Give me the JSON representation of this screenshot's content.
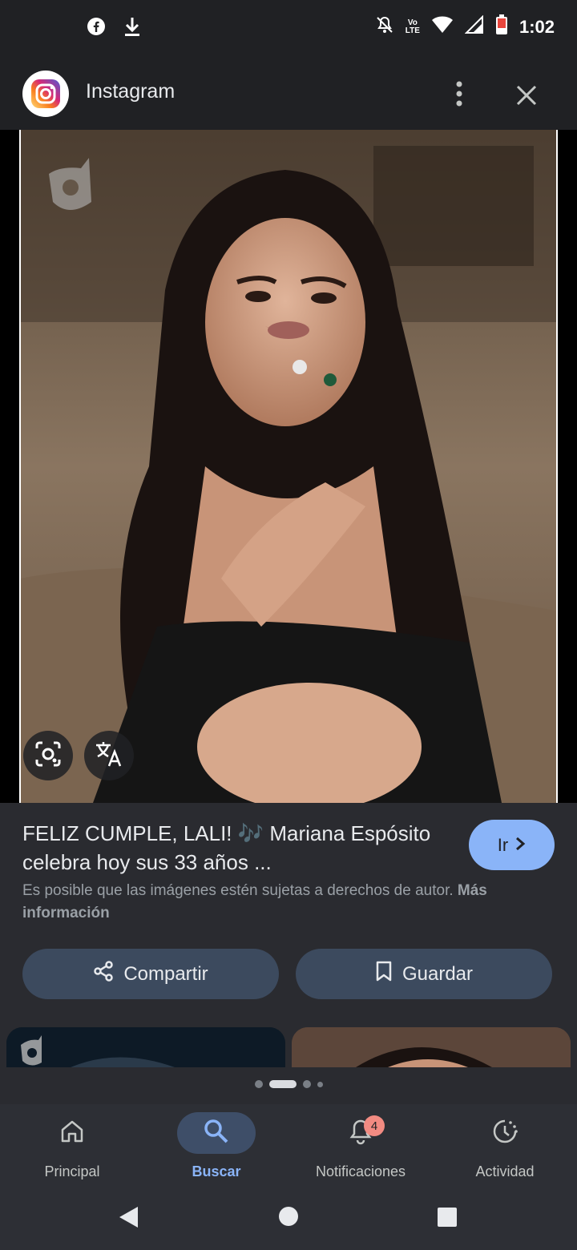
{
  "status_bar": {
    "time": "1:02",
    "volte_top": "Vo",
    "volte_bottom": "LTE",
    "left_icons": [
      "facebook-icon",
      "download-icon"
    ],
    "right_icons": [
      "notifications-off-icon",
      "volte-icon",
      "wifi-icon",
      "signal-icon",
      "battery-icon"
    ],
    "battery_color": "#f28b82"
  },
  "header": {
    "app_name": "Instagram",
    "actions": [
      "more-icon",
      "close-icon"
    ]
  },
  "image": {
    "overlay_buttons": [
      "lens-icon",
      "translate-icon"
    ]
  },
  "result": {
    "title": "FELIZ CUMPLE, LALI! 🎶 Mariana Espósito celebra hoy sus 33 años ...",
    "go_label": "Ir",
    "copyright_text": "Es posible que las imágenes estén sujetas a derechos de autor.",
    "copyright_link": "Más información",
    "share_label": "Compartir",
    "save_label": "Guardar"
  },
  "carousel": {
    "page_count": 4,
    "active_index": 1
  },
  "bottom_nav": {
    "items": [
      {
        "label": "Principal",
        "icon": "home-icon",
        "active": false
      },
      {
        "label": "Buscar",
        "icon": "search-icon",
        "active": true
      },
      {
        "label": "Notificaciones",
        "icon": "bell-icon",
        "active": false,
        "badge": "4"
      },
      {
        "label": "Actividad",
        "icon": "activity-icon",
        "active": false
      }
    ]
  },
  "colors": {
    "accent": "#8ab4f8",
    "background": "#1f2024",
    "surface": "#2a2b30",
    "pill": "#3c4a5e",
    "badge": "#f28b82"
  }
}
